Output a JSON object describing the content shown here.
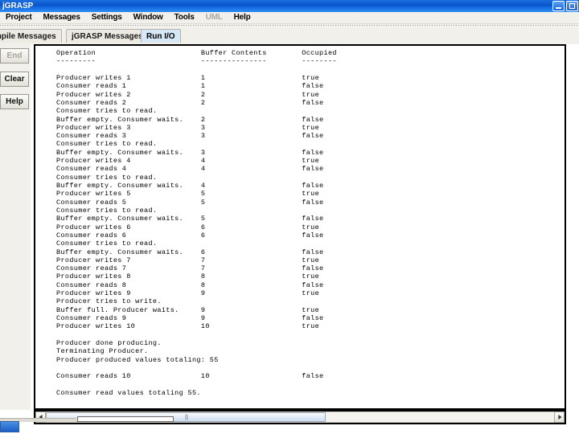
{
  "window": {
    "title": "jGRASP",
    "controls": [
      {
        "name": "minimize",
        "label": ""
      },
      {
        "name": "maximize",
        "label": ""
      }
    ]
  },
  "menubar": {
    "items": [
      {
        "label": "Project",
        "mnemonic": "P",
        "disabled": false
      },
      {
        "label": "Messages",
        "mnemonic": "M",
        "disabled": false
      },
      {
        "label": "Settings",
        "mnemonic": "S",
        "disabled": false
      },
      {
        "label": "Window",
        "mnemonic": "W",
        "disabled": false
      },
      {
        "label": "Tools",
        "mnemonic": "T",
        "disabled": false
      },
      {
        "label": "UML",
        "mnemonic": "U",
        "disabled": true
      },
      {
        "label": "Help",
        "mnemonic": "H",
        "disabled": false
      }
    ]
  },
  "tabs": [
    {
      "label": "mpile Messages",
      "selected": false
    },
    {
      "label": "jGRASP Messages",
      "selected": false
    },
    {
      "label": "Run I/O",
      "selected": true
    }
  ],
  "sidebar": {
    "buttons": [
      {
        "label": "End",
        "disabled": true
      },
      {
        "label": "Clear",
        "disabled": false
      },
      {
        "label": "Help",
        "disabled": false
      }
    ]
  },
  "console": {
    "columns": [
      "Operation",
      "Buffer Contents",
      "Occupied"
    ],
    "rules": [
      "---------",
      "---------------",
      "--------"
    ],
    "text": "Operation                        Buffer Contents        Occupied\n---------                        ---------------        --------\n\nProducer writes 1                1                      true\nConsumer reads 1                 1                      false\nProducer writes 2                2                      true\nConsumer reads 2                 2                      false\nConsumer tries to read.\nBuffer empty. Consumer waits.    2                      false\nProducer writes 3                3                      true\nConsumer reads 3                 3                      false\nConsumer tries to read.\nBuffer empty. Consumer waits.    3                      false\nProducer writes 4                4                      true\nConsumer reads 4                 4                      false\nConsumer tries to read.\nBuffer empty. Consumer waits.    4                      false\nProducer writes 5                5                      true\nConsumer reads 5                 5                      false\nConsumer tries to read.\nBuffer empty. Consumer waits.    5                      false\nProducer writes 6                6                      true\nConsumer reads 6                 6                      false\nConsumer tries to read.\nBuffer empty. Consumer waits.    6                      false\nProducer writes 7                7                      true\nConsumer reads 7                 7                      false\nProducer writes 8                8                      true\nConsumer reads 8                 8                      false\nProducer writes 9                9                      true\nProducer tries to write.\nBuffer full. Producer waits.     9                      true\nConsumer reads 9                 9                      false\nProducer writes 10               10                     true\n\nProducer done producing.\nTerminating Producer.\nProducer produced values totaling: 55\n\nConsumer reads 10                10                     false\n\nConsumer read values totaling 55."
  },
  "scrollbar": {
    "orientation": "horizontal",
    "thumb_percent": 55,
    "left_arrow": "left-arrow-icon",
    "right_arrow": "right-arrow-icon"
  },
  "colors": {
    "titlebar": "#0a56cc",
    "chrome": "#f1f0ea",
    "selected_tab": "#d6e8f7",
    "console_bg": "#ffffff",
    "console_fg": "#000000"
  }
}
